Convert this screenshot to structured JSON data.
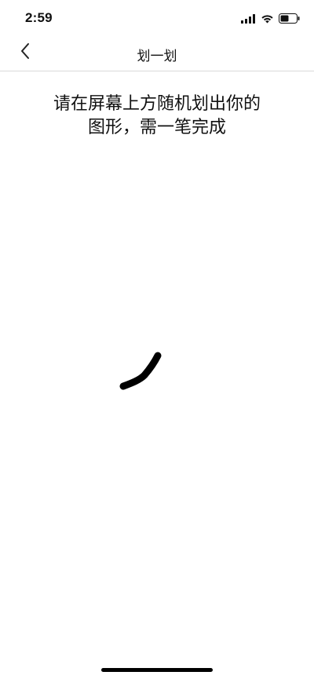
{
  "status_bar": {
    "time": "2:59",
    "icons": [
      "signal-icon",
      "wifi-icon",
      "battery-icon"
    ]
  },
  "nav": {
    "back_icon": "chevron-left-icon",
    "title": "划一划"
  },
  "instruction": {
    "line1": "请在屏幕上方随机划出你的",
    "line2": "图形，需一笔完成"
  },
  "colors": {
    "stroke": "#000000",
    "divider": "#d9d9d9",
    "background": "#ffffff"
  }
}
